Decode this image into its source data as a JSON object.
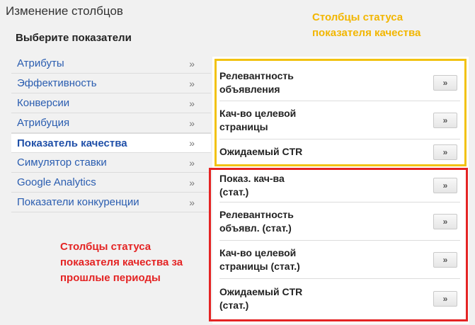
{
  "header": {
    "title": "Изменение столбцов",
    "subtitle": "Выберите показатели"
  },
  "sidebar": {
    "chevron": "»",
    "items": [
      {
        "label": "Атрибуты"
      },
      {
        "label": "Эффективность"
      },
      {
        "label": "Конверсии"
      },
      {
        "label": "Атрибуция"
      },
      {
        "label": "Показатель качества",
        "active": true
      },
      {
        "label": "Симулятор ставки"
      },
      {
        "label": "Google Analytics"
      },
      {
        "label": "Показатели конкуренции"
      }
    ]
  },
  "columns": {
    "add_label": "»",
    "current": [
      {
        "line1": "Релевантность",
        "line2": "объявления"
      },
      {
        "line1": "Кач-во целевой",
        "line2": "страницы"
      },
      {
        "line1": "Ожидаемый CTR",
        "line2": ""
      }
    ],
    "historical": [
      {
        "line1": "Показ. кач-ва",
        "line2": "(стат.)"
      },
      {
        "line1": "Релевантность",
        "line2": "объявл. (стат.)"
      },
      {
        "line1": "Кач-во целевой",
        "line2": "страницы (стат.)"
      },
      {
        "line1": "Ожидаемый CTR",
        "line2": "(стат.)"
      }
    ]
  },
  "annotations": {
    "yellow_line1": "Столбцы статуса",
    "yellow_line2": "показателя качества",
    "red_line1": "Столбцы статуса",
    "red_line2": "показателя качества за",
    "red_line3": "прошлые периоды",
    "yellow_color": "#f2c211",
    "red_color": "#e42424"
  }
}
